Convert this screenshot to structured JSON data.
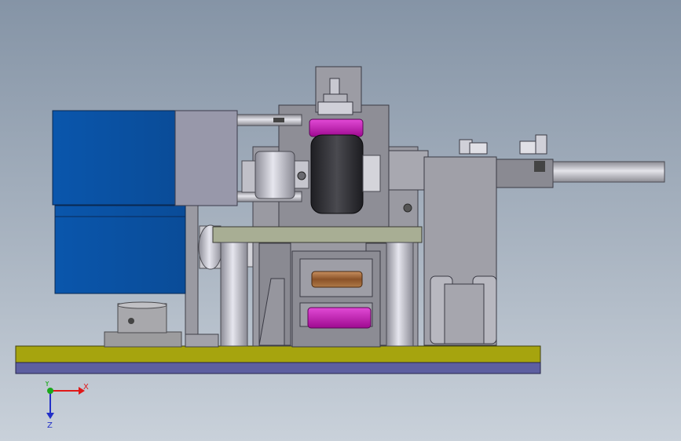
{
  "triad": {
    "x_label": "X",
    "y_label": "Y",
    "z_label": "Z",
    "x_color": "#e01818",
    "y_color": "#1aa81a",
    "z_color": "#2230c8"
  },
  "colors": {
    "base_plate": "#a6a40e",
    "base_lower": "#5d5fa0",
    "motor_blue": "#0a55a8",
    "motor_grey": "#9698a8",
    "frame_grey": "#9d9da4",
    "roller_dark": "#2a2a2e",
    "magenta": "#c010b0",
    "copper": "#9a6030",
    "mount_plate": "#a8ae94"
  }
}
